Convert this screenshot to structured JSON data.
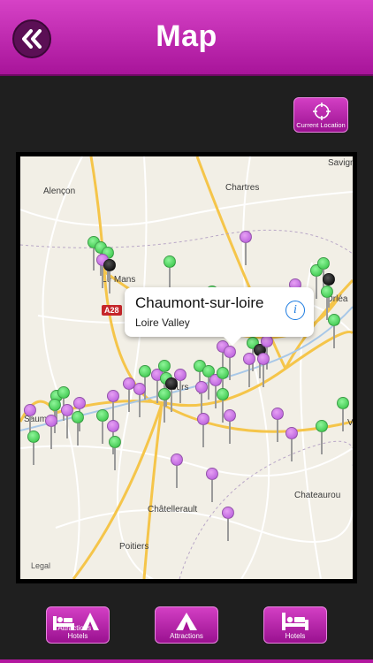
{
  "header": {
    "title": "Map",
    "back_icon": "double-chevron-left-icon",
    "colors": {
      "bar": "#c02bb1",
      "back": "#5b0f55"
    }
  },
  "current_location": {
    "label": "Current Location",
    "icon": "crosshair-icon"
  },
  "map": {
    "cities": [
      "Alençon",
      "Chartres",
      "Savign",
      "Le Mans",
      "Orléa",
      "Tours",
      "Saum",
      "Châtellerault",
      "Chateaurou",
      "Poitiers",
      "V"
    ],
    "road_label": "A28",
    "legal": "Legal",
    "pin_colors": {
      "attraction": "#b155d8",
      "hotel": "#2dbf3e",
      "selected": "#000000"
    }
  },
  "callout": {
    "title": "Chaumont-sur-loire",
    "subtitle": "Loire Valley",
    "icon": "info-icon"
  },
  "bottom_bar": {
    "attractions_hotels": "Attractions & Hotels",
    "attractions": "Attractions",
    "hotels": "Hotels"
  }
}
